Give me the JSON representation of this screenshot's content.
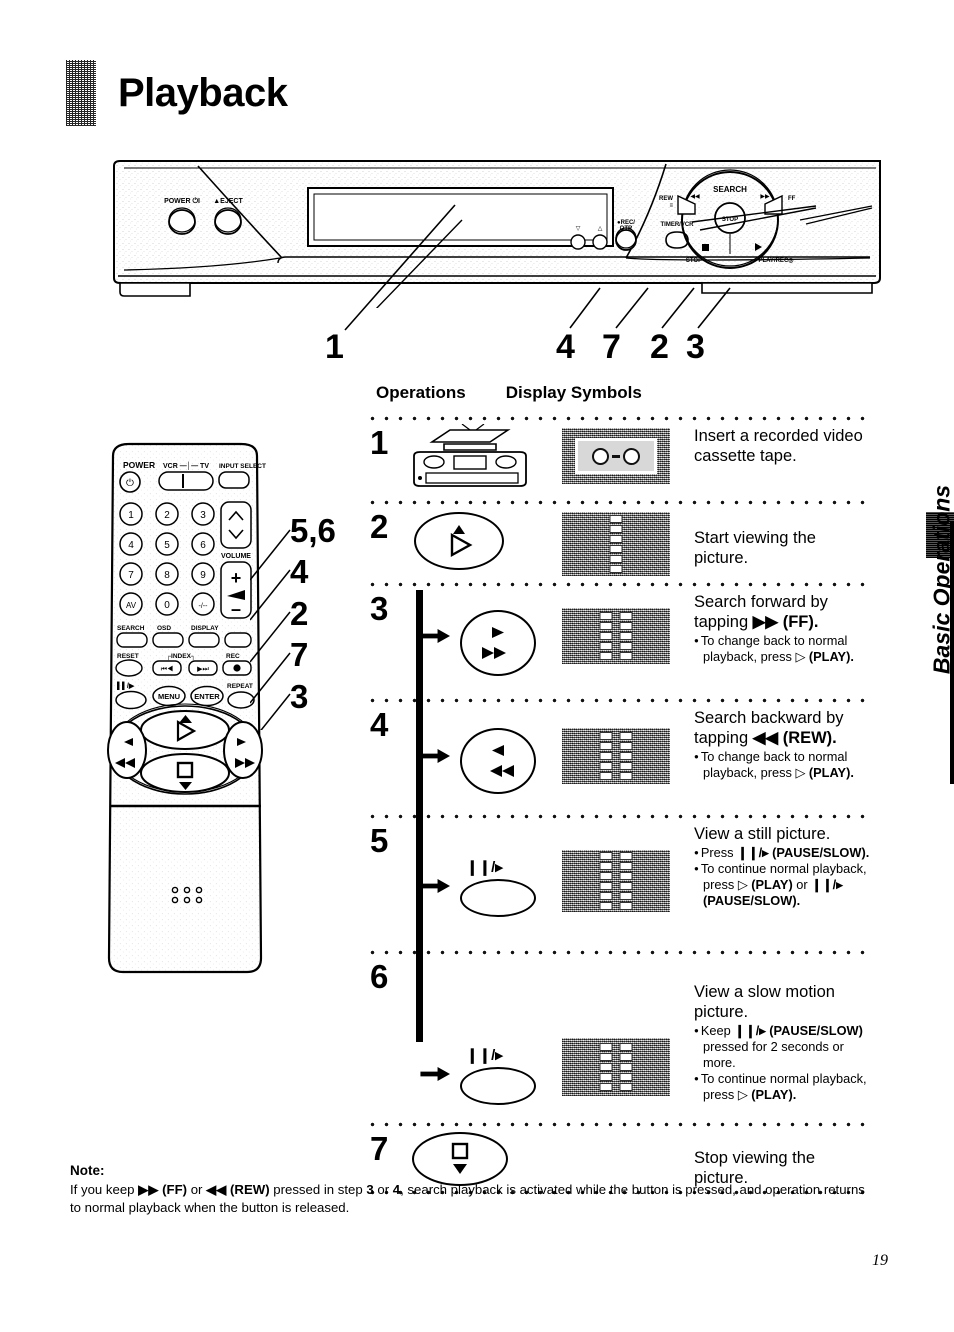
{
  "page": {
    "title": "Playback",
    "number": "19",
    "side_tab_label": "Basic Operations"
  },
  "vcr_panel": {
    "labels": {
      "power": "POWER ⏻ I",
      "eject": "▲ EJECT",
      "channel_down": "▽",
      "channel_up": "△",
      "rec_otr": "● REC / OTR",
      "timer_vcr": "TIMER / VCR",
      "rew": "REW",
      "search": "SEARCH",
      "ff": "FF",
      "stop": "STOP",
      "play_rec": "PLAY/REC"
    },
    "callouts": [
      "1",
      "4",
      "7",
      "2",
      "3"
    ]
  },
  "remote": {
    "callouts": [
      "5,6",
      "4",
      "2",
      "7",
      "3"
    ],
    "labels": {
      "power": "POWER",
      "vcr_tv": "VCR — TV",
      "input_select": "INPUT SELECT",
      "volume": "VOLUME",
      "search": "SEARCH",
      "osd": "OSD",
      "display": "DISPLAY",
      "reset": "RESET",
      "index": "INDEX",
      "rec": "REC",
      "pause_slow": "❙❙/▸",
      "menu": "MENU",
      "enter": "ENTER",
      "repeat": "REPEAT",
      "av": "AV",
      "plus_minus": "-/--"
    },
    "keypad": [
      "1",
      "2",
      "3",
      "4",
      "5",
      "6",
      "7",
      "8",
      "9",
      "AV",
      "0",
      "-/--"
    ]
  },
  "columns": {
    "operations": "Operations",
    "display_symbols": "Display Symbols"
  },
  "steps": [
    {
      "num": "1",
      "op_icon": "vcr-insert-cassette-icon",
      "display_icon": "tv-cassette-symbol",
      "desc": "Insert a recorded video cassette tape.",
      "bullets": []
    },
    {
      "num": "2",
      "op_icon": "play-button-oval",
      "op_label": "▷",
      "display_icon": "tv-play-symbol",
      "desc": "Start viewing the picture.",
      "bullets": []
    },
    {
      "num": "3",
      "op_icon": "ff-button-oval",
      "display_icon": "tv-ff-symbol",
      "desc": "Search forward by tapping ▶▶ (FF).",
      "desc_plain": "Search forward by tapping",
      "desc_bold": "▶▶ (FF).",
      "bullets": [
        {
          "text": "To change back to normal playback, press ▷ (PLAY).",
          "plain": "To change back to normal playback, press ▷ ",
          "bold": "(PLAY)."
        }
      ]
    },
    {
      "num": "4",
      "op_icon": "rew-button-oval",
      "display_icon": "tv-rew-symbol",
      "desc": "Search backward by tapping ◀◀ (REW).",
      "desc_plain": "Search backward by tapping",
      "desc_bold": "◀◀ (REW).",
      "bullets": [
        {
          "text": "To change back to normal playback, press ▷ (PLAY).",
          "plain": "To change back to normal playback, press ▷ ",
          "bold": "(PLAY)."
        }
      ]
    },
    {
      "num": "5",
      "op_icon": "pause-slow-button-oval",
      "op_label": "❙❙/▸",
      "display_icon": "tv-still-symbol",
      "desc": "View a still picture.",
      "bullets": [
        {
          "text": "Press ❙❙/▸ (PAUSE/SLOW).",
          "plain": "Press ",
          "bold": "❙❙/▸ (PAUSE/SLOW)."
        },
        {
          "text": "To continue normal playback, press ▷ (PLAY) or ❙❙/▸ (PAUSE/SLOW).",
          "plain": "To continue normal playback, press ▷ ",
          "bold": "(PLAY)",
          "plain2": " or ",
          "bold2": "❙❙/▸ (PAUSE/SLOW)."
        }
      ]
    },
    {
      "num": "6",
      "op_icon": "pause-slow-button-oval",
      "op_label": "❙❙/▸",
      "display_icon": "tv-slow-symbol",
      "desc": "View a slow motion picture.",
      "bullets": [
        {
          "text": "Keep ❙❙/▸ (PAUSE/SLOW) pressed for 2 seconds or more.",
          "plain": "Keep ",
          "bold": "❙❙/▸ (PAUSE/SLOW)",
          "plain2": " pressed for 2 seconds or more."
        },
        {
          "text": "To continue normal playback, press ▷ (PLAY).",
          "plain": "To continue normal playback, press ▷ ",
          "bold": "(PLAY)."
        }
      ]
    },
    {
      "num": "7",
      "op_icon": "stop-button-oval",
      "op_label": "□",
      "display_icon": "none",
      "desc": "Stop viewing the picture.",
      "bullets": []
    }
  ],
  "note": {
    "title": "Note:",
    "part1": "If you keep ",
    "bold1": "▶▶ (FF)",
    "part2": " or ",
    "bold2": "◀◀ (REW)",
    "part3": " pressed in step ",
    "bold3": "3",
    "part4": " or ",
    "bold4": "4",
    "part5": ", search playback is activated while the button is pressed, and operation returns to normal playback when the button is released."
  }
}
